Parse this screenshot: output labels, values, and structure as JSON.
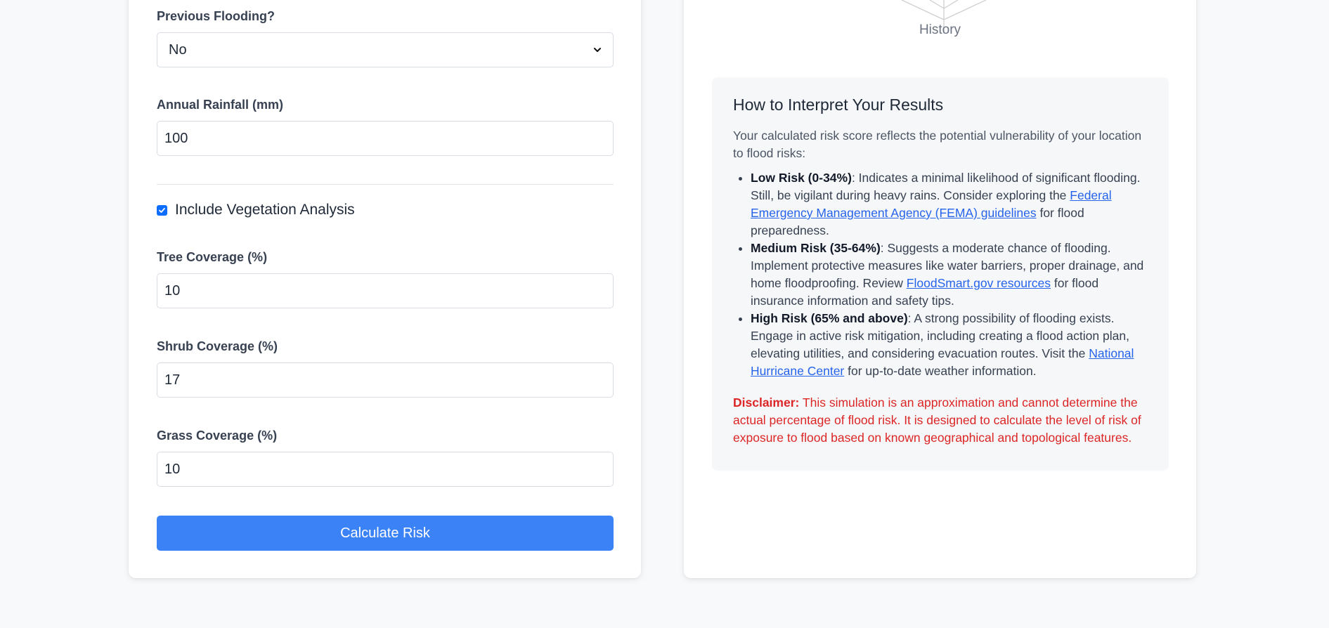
{
  "form": {
    "previous_flooding": {
      "label": "Previous Flooding?",
      "value": "No"
    },
    "annual_rainfall": {
      "label": "Annual Rainfall (mm)",
      "value": "100"
    },
    "vegetation": {
      "label": "Include Vegetation Analysis",
      "checked": true
    },
    "tree_coverage": {
      "label": "Tree Coverage (%)",
      "value": "10"
    },
    "shrub_coverage": {
      "label": "Shrub Coverage (%)",
      "value": "17"
    },
    "grass_coverage": {
      "label": "Grass Coverage (%)",
      "value": "10"
    },
    "submit_label": "Calculate Risk"
  },
  "results": {
    "radar_axis_label": "History",
    "interpret": {
      "title": "How to Interpret Your Results",
      "intro": "Your calculated risk score reflects the potential vulnerability of your location to flood risks:",
      "low": {
        "label": "Low Risk (0-34%)",
        "text_before": ": Indicates a minimal likelihood of significant flooding. Still, be vigilant during heavy rains. Consider exploring the ",
        "link": "Federal Emergency Management Agency (FEMA) guidelines",
        "text_after": " for flood preparedness."
      },
      "medium": {
        "label": "Medium Risk (35-64%)",
        "text_before": ": Suggests a moderate chance of flooding. Implement protective measures like water barriers, proper drainage, and home floodproofing. Review ",
        "link": "FloodSmart.gov resources",
        "text_after": " for flood insurance information and safety tips."
      },
      "high": {
        "label": "High Risk (65% and above)",
        "text_before": ": A strong possibility of flooding exists. Engage in active risk mitigation, including creating a flood action plan, elevating utilities, and considering evacuation routes. Visit the ",
        "link": "National Hurricane Center",
        "text_after": " for up-to-date weather information."
      },
      "disclaimer_label": "Disclaimer:",
      "disclaimer_text": " This simulation is an approximation and cannot determine the actual percentage of flood risk. It is designed to calculate the level of risk of exposure to flood based on known geographical and topological features."
    }
  },
  "colors": {
    "primary": "#3b82f6",
    "link": "#2563eb",
    "danger": "#dc2626",
    "background": "#f8f9fb"
  }
}
